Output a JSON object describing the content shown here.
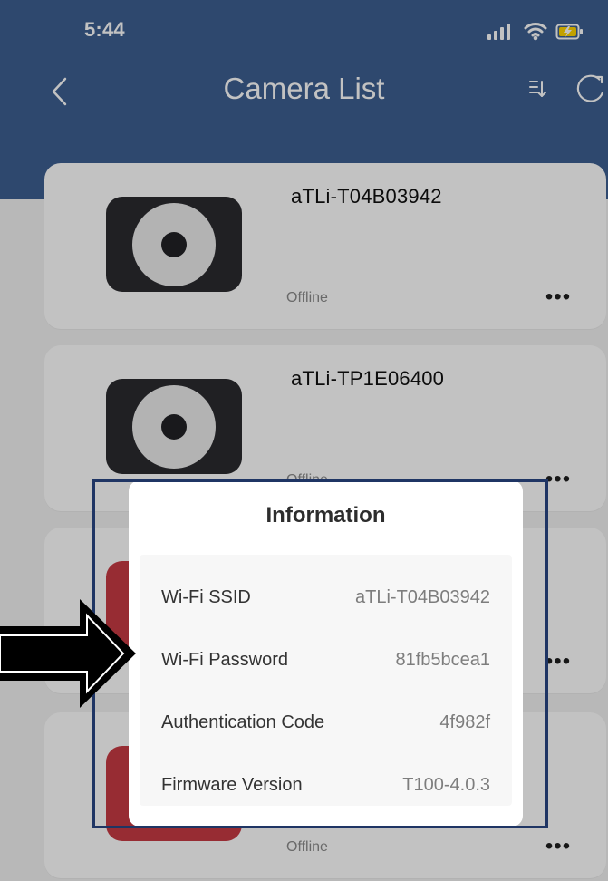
{
  "status_bar": {
    "time": "5:44",
    "icons": [
      "signal-icon",
      "wifi-icon",
      "battery-charging-icon"
    ]
  },
  "nav": {
    "title": "Camera List",
    "back_icon": "chevron-left-icon",
    "sort_icon": "sort-icon",
    "refresh_icon": "refresh-icon"
  },
  "cameras": [
    {
      "name": "aTLi-T04B03942",
      "status": "Offline",
      "thumbnail": "camera-dark-icon",
      "more_label": "•••"
    },
    {
      "name": "aTLi-TP1E06400",
      "status": "Offline",
      "thumbnail": "camera-dark-icon",
      "more_label": "•••"
    },
    {
      "name": "",
      "status": "",
      "thumbnail": "camera-red-icon",
      "more_label": "•••"
    },
    {
      "name": "",
      "status": "Offline",
      "thumbnail": "camera-red-icon",
      "more_label": "•••"
    }
  ],
  "information_modal": {
    "title": "Information",
    "rows": [
      {
        "label": "Wi-Fi SSID",
        "value": "aTLi-T04B03942"
      },
      {
        "label": "Wi-Fi Password",
        "value": "81fb5bcea1"
      },
      {
        "label": "Authentication Code",
        "value": "4f982f"
      },
      {
        "label": "Firmware Version",
        "value": "T100-4.0.3"
      }
    ]
  },
  "annotations": {
    "arrow_icon": "right-arrow-icon",
    "highlight_color": "#1f3564",
    "arrow_color": "#000000"
  },
  "colors": {
    "header_blue": "#3d5f91",
    "overlay": "rgba(0,0,0,0.24)",
    "thumb_dark": "#2b2b2f",
    "thumb_red": "#c73a43"
  }
}
